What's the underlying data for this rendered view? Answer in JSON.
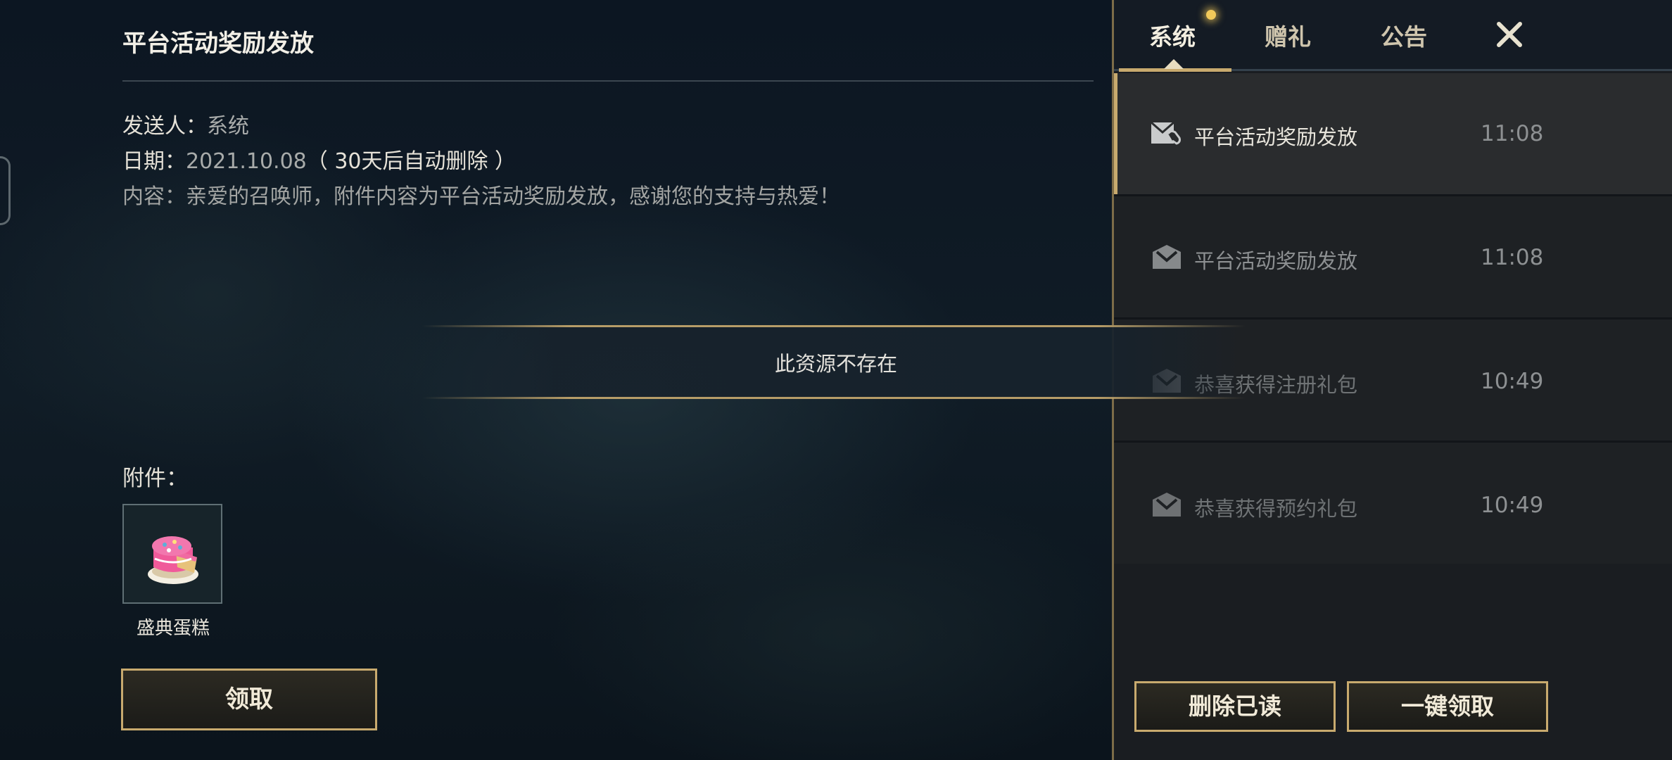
{
  "detail": {
    "title": "平台活动奖励发放",
    "sender_label": "发送人：",
    "sender_value": "系统",
    "date_label": "日期：",
    "date_value": "2021.10.08",
    "date_note": "（ 30天后自动删除 ）",
    "content_label": "内容：",
    "content_value": "亲爱的召唤师，附件内容为平台活动奖励发放，感谢您的支持与热爱！",
    "attachment_label": "附件：",
    "attachment_item": {
      "name": "盛典蛋糕",
      "icon": "cake-icon"
    },
    "claim_label": "领取"
  },
  "tabs": [
    {
      "label": "系统",
      "active": true,
      "has_notification_dot": true
    },
    {
      "label": "赠礼",
      "active": false
    },
    {
      "label": "公告",
      "active": false
    }
  ],
  "close_icon": "close-icon",
  "mails": [
    {
      "title": "平台活动奖励发放",
      "time": "11:08",
      "selected": true,
      "icon": "mail-attachment-icon"
    },
    {
      "title": "平台活动奖励发放",
      "time": "11:08",
      "selected": false,
      "icon": "mail-icon"
    },
    {
      "title": "恭喜获得注册礼包",
      "time": "10:49",
      "selected": false,
      "icon": "mail-icon"
    },
    {
      "title": "恭喜获得预约礼包",
      "time": "10:49",
      "selected": false,
      "icon": "mail-icon"
    }
  ],
  "actions": {
    "delete_read": "删除已读",
    "claim_all": "一键领取"
  },
  "toast": {
    "message": "此资源不存在"
  },
  "colors": {
    "accent_gold": "#c8aa6e",
    "panel_bg": "#1a1d21",
    "selected_row_bg": "#2a2c2e",
    "notification_dot": "#f1c95a"
  }
}
